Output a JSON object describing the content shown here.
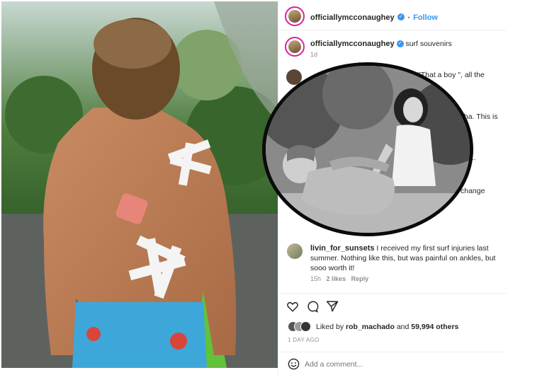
{
  "post": {
    "header": {
      "username": "officiallymcconaughey",
      "follow_label": "Follow",
      "separator": "•"
    },
    "caption": {
      "username": "officiallymcconaughey",
      "text": "surf souvenirs",
      "age": "1d"
    },
    "comments_partial": [
      {
        "visible_text": "\"That a boy \", all the"
      },
      {
        "visible_text": "tha. This is"
      },
      {
        "visible_text": "\"s\"..."
      },
      {
        "visible_text": "change"
      }
    ],
    "comment": {
      "username": "livin_for_sunsets",
      "text": "I received my first surf injuries last summer. Nothing like this, but was painful on ankles, but sooo worth it!",
      "age": "15h",
      "likes": "2 likes",
      "reply_label": "Reply"
    },
    "likes": {
      "prefix": "Liked by",
      "user": "rob_machado",
      "suffix": "and",
      "count": "59,994 others"
    },
    "timestamp": "1 DAY AGO",
    "add_comment": {
      "placeholder": "Add a comment..."
    }
  },
  "icons": {
    "heart": "heart-icon",
    "comment": "comment-icon",
    "share": "share-icon",
    "emoji": "emoji-icon",
    "verified": "verified-badge-icon"
  },
  "colors": {
    "link": "#3897f0",
    "story_ring": "#d6249f",
    "verified": "#3897f0"
  }
}
